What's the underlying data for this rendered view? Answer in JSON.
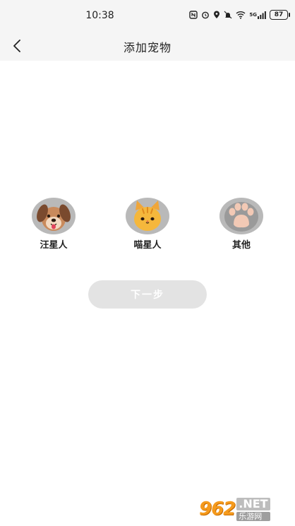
{
  "status_bar": {
    "time": "10:38",
    "network_type": "5G",
    "battery": "87"
  },
  "nav": {
    "title": "添加宠物"
  },
  "pets": [
    {
      "label": "汪星人",
      "icon": "dog-icon"
    },
    {
      "label": "喵星人",
      "icon": "cat-icon"
    },
    {
      "label": "其他",
      "icon": "paw-icon"
    }
  ],
  "actions": {
    "next_label": "下一步"
  },
  "watermark": {
    "logo": "962",
    "net": ".NET",
    "sub": "乐游网"
  },
  "colors": {
    "nav_background": "#f5f5f5",
    "avatar_background": "#b9b9b9",
    "button_disabled": "#e3e3e3",
    "cat_orange": "#f5b73c",
    "dog_brown": "#c98a5c"
  }
}
